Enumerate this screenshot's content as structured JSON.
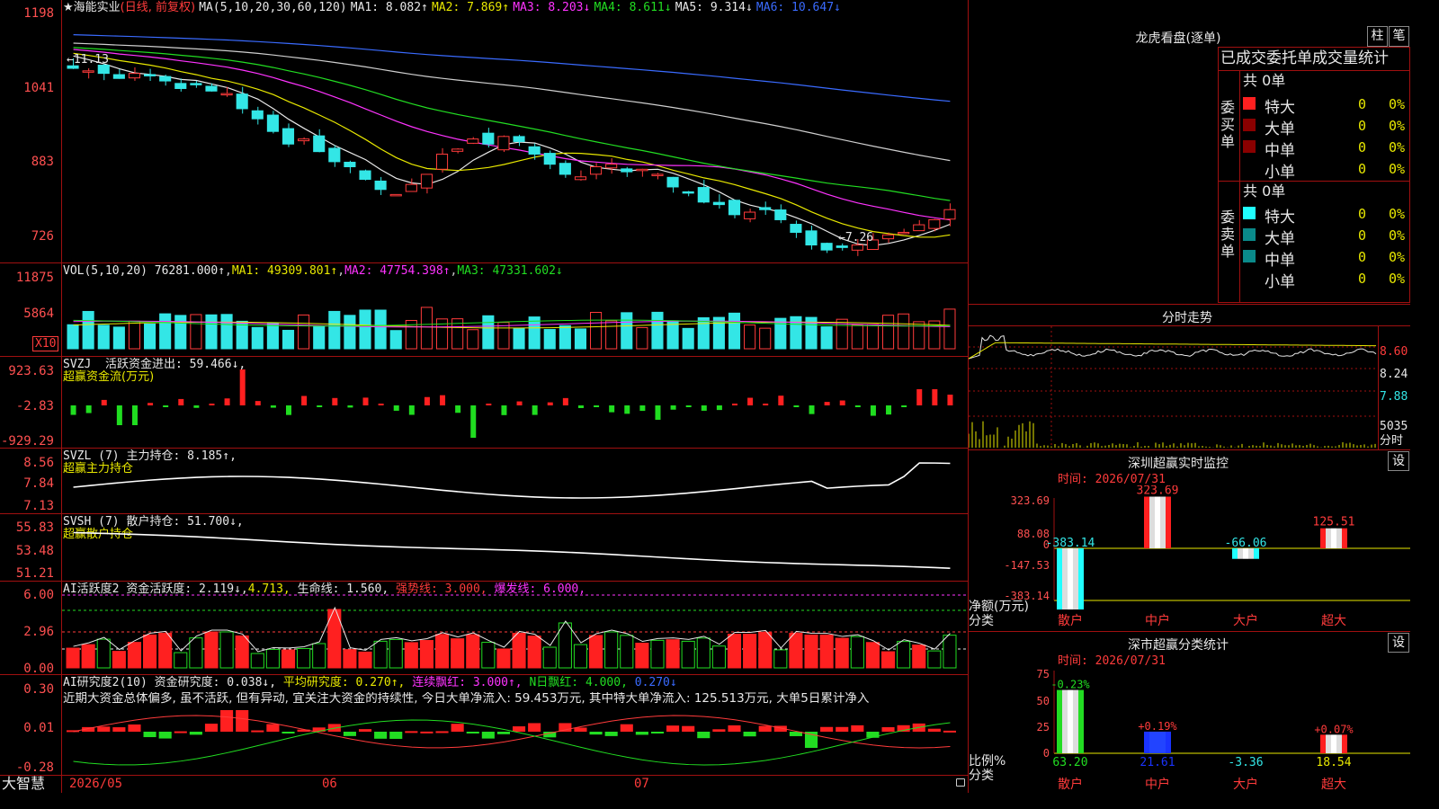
{
  "main_header": {
    "star": "★",
    "stock_name": "海能实业",
    "period": "(日线, 前复权)",
    "ma_params": "MA(5,10,20,30,60,120)",
    "ma1": "MA1: 8.082↑",
    "ma2": "MA2: 7.869↑",
    "ma3": "MA3: 8.203↓",
    "ma4": "MA4: 8.611↓",
    "ma5": "MA5: 9.314↓",
    "ma6": "MA6: 10.647↓"
  },
  "main_axis": [
    "1198",
    "1041",
    "883",
    "726"
  ],
  "main_annotations": {
    "high": "←11.13",
    "low": "←7.26"
  },
  "vol_header": {
    "name": "VOL(5,10,20)",
    "value": "76281.000↑",
    "ma1": "MA1: 49309.801↑",
    "ma2": "MA2: 47754.398↑",
    "ma3": "MA3: 47331.602↓"
  },
  "vol_axis": [
    "11875",
    "5864"
  ],
  "vol_unit": "X10",
  "svzj_header": {
    "name": "SVZJ",
    "label": "活跃资金进出: 59.466↓,",
    "sub": "超赢资金流(万元)"
  },
  "svzj_axis": [
    "923.63",
    "-2.83",
    "-929.29"
  ],
  "svzl_header": {
    "name": "SVZL (7)",
    "label": "主力持仓: 8.185↑,",
    "sub": "超赢主力持仓"
  },
  "svzl_axis": [
    "8.56",
    "7.84",
    "7.13"
  ],
  "svsh_header": {
    "name": "SVSH (7)",
    "label": "散户持仓: 51.700↓,",
    "sub": "超赢散户持仓"
  },
  "svsh_axis": [
    "55.83",
    "53.48",
    "51.21"
  ],
  "ai1_header": {
    "name": "AI活跃度2",
    "a": "资金活跃度: 2.119↓,",
    "b": "4.713,",
    "c": "生命线: 1.560,",
    "d": "强势线: 3.000,",
    "e": "爆发线: 6.000,"
  },
  "ai1_axis": [
    "6.00",
    "2.96",
    "0.00"
  ],
  "ai2_header": {
    "name": "AI研究度2(10)",
    "a": "资金研究度: 0.038↓,",
    "b": "平均研究度: 0.270↑,",
    "c": "连续飘红: 3.000↑,",
    "d": "N日飘红: 4.000,",
    "e": "0.270↓"
  },
  "ai2_comment": "近期大资金总体偏多, 虽不活跃, 但有异动, 宜关注大资金的持续性, 今日大单净流入: 59.453万元, 其中特大单净流入: 125.513万元, 大单5日累计净入",
  "ai2_axis": [
    "0.30",
    "0.01",
    "-0.28"
  ],
  "bottom_bar": {
    "brand": "大智慧",
    "d1": "2026/05",
    "d2": "06",
    "d3": "07"
  },
  "right_top": {
    "title": "龙虎看盘(逐单)",
    "btn_bar": "柱",
    "btn_pen": "笔",
    "tabs_text": "已成交委托单成交量统计",
    "buy_label": "委买单",
    "sell_label": "委卖单",
    "buy_total": "共 0单",
    "sell_total": "共 0单",
    "rows": [
      {
        "name": "特大",
        "count": "0",
        "pct": "0%"
      },
      {
        "name": "大单",
        "count": "0",
        "pct": "0%"
      },
      {
        "name": "中单",
        "count": "0",
        "pct": "0%"
      },
      {
        "name": "小单",
        "count": "0",
        "pct": "0%"
      }
    ],
    "buy_colors": [
      "#ff2020",
      "#8a0000",
      "#8a0000",
      ""
    ],
    "sell_colors": [
      "#20ffff",
      "#0a8a8a",
      "#0a8a8a",
      ""
    ]
  },
  "intraday": {
    "title": "分时走势",
    "axis": [
      "8.60",
      "8.24",
      "7.88",
      "5035"
    ],
    "unit": "分时"
  },
  "monitor": {
    "title": "深圳超赢实时监控",
    "btn": "设",
    "time": "时间: 2026/07/31",
    "axis": [
      "323.69",
      "88.08",
      "0",
      "-147.53",
      "-383.14"
    ],
    "unit1": "净额(万元)",
    "unit2": "分类",
    "categories": [
      "散户",
      "中户",
      "大户",
      "超大"
    ],
    "values": [
      -383.14,
      323.69,
      -66.06,
      125.51
    ],
    "labels": [
      "-383.14",
      "323.69",
      "-66.06",
      "125.51"
    ]
  },
  "classify": {
    "title": "深市超赢分类统计",
    "btn": "设",
    "time": "时间: 2026/07/31",
    "axis": [
      "75",
      "50",
      "25",
      "0"
    ],
    "unit1": "比例%",
    "unit2": "分类",
    "categories": [
      "散户",
      "中户",
      "大户",
      "超大"
    ],
    "values": [
      63.2,
      21.61,
      -3.36,
      18.54
    ],
    "labels": [
      "63.20",
      "21.61",
      "-3.36",
      "18.54"
    ],
    "change_labels": [
      "-0.23%",
      "+0.19%",
      "",
      "+0.07%"
    ]
  },
  "chart_data": {
    "type": "candlestick",
    "title": "海能实业 (日线, 前复权)",
    "ylim": [
      7.26,
      11.98
    ],
    "x_labels": [
      "2026/05",
      "06",
      "07"
    ],
    "high_mark": 11.13,
    "low_mark": 7.26,
    "closes": [
      11.0,
      10.95,
      10.9,
      10.8,
      10.9,
      10.85,
      10.75,
      10.6,
      10.7,
      10.55,
      10.5,
      10.2,
      10.0,
      9.75,
      9.5,
      9.6,
      9.35,
      9.15,
      9.05,
      8.8,
      8.6,
      8.5,
      8.7,
      8.9,
      9.3,
      9.4,
      9.6,
      9.5,
      9.65,
      9.55,
      9.3,
      9.1,
      8.9,
      8.85,
      9.05,
      9.1,
      8.95,
      9.0,
      8.9,
      8.65,
      8.55,
      8.35,
      8.3,
      8.1,
      8.15,
      8.2,
      8.0,
      7.75,
      7.5,
      7.4,
      7.45,
      7.5,
      7.6,
      7.7,
      7.75,
      7.9,
      8.0,
      8.2
    ],
    "ma_lines": [
      "MA1",
      "MA2",
      "MA3",
      "MA4",
      "MA5",
      "MA6"
    ]
  }
}
